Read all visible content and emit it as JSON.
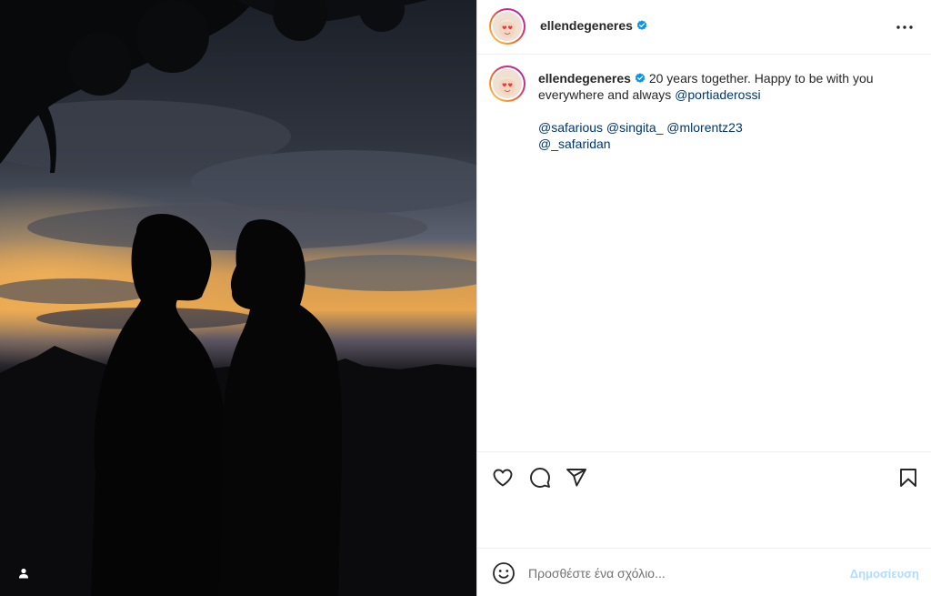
{
  "post": {
    "username": "ellendegeneres",
    "verified": true
  },
  "caption": {
    "username": "ellendegeneres",
    "text": "20 years together. Happy to be with you everywhere and always",
    "mention": "@portiaderossi",
    "tags": [
      "@safarious",
      "@singita_",
      "@mlorentz23",
      "@_safaridan"
    ]
  },
  "comment": {
    "placeholder": "Προσθέστε ένα σχόλιο...",
    "post_label": "Δημοσίευση"
  },
  "icons": {
    "more": "more-options-icon",
    "like": "heart-icon",
    "comment": "comment-icon",
    "share": "send-icon",
    "save": "bookmark-icon",
    "emoji": "emoji-icon",
    "tagged": "user-icon",
    "verified": "verified-badge-icon"
  },
  "colors": {
    "mention": "#00376b",
    "verified": "#0095f6",
    "post_disabled": "#b3dbff"
  }
}
